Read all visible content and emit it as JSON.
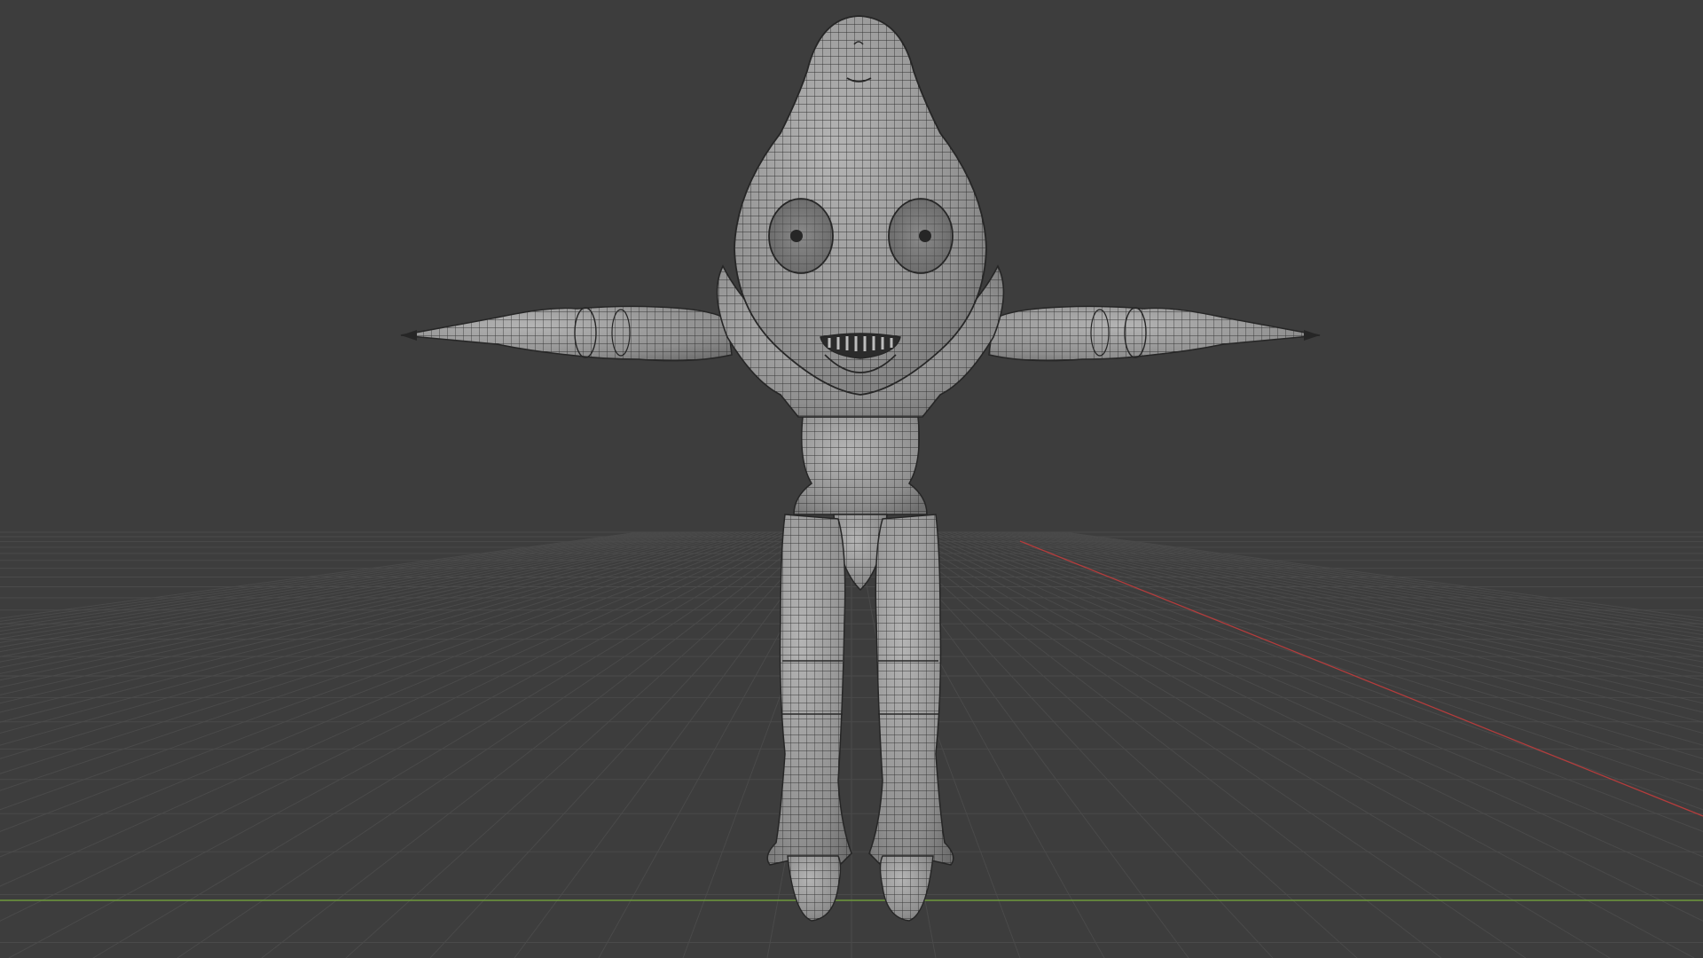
{
  "viewport": {
    "background_color": "#3d3d3d",
    "grid_color": "#4a4a4a",
    "x_axis_color": "#b43c3c",
    "y_axis_color": "#6f9a3c",
    "mesh_fill_color": "#8d8d8d",
    "mesh_wire_color": "#262626"
  },
  "scene": {
    "object": "character-mesh",
    "display_mode": "solid-with-wireframe",
    "pose": "t-pose"
  }
}
